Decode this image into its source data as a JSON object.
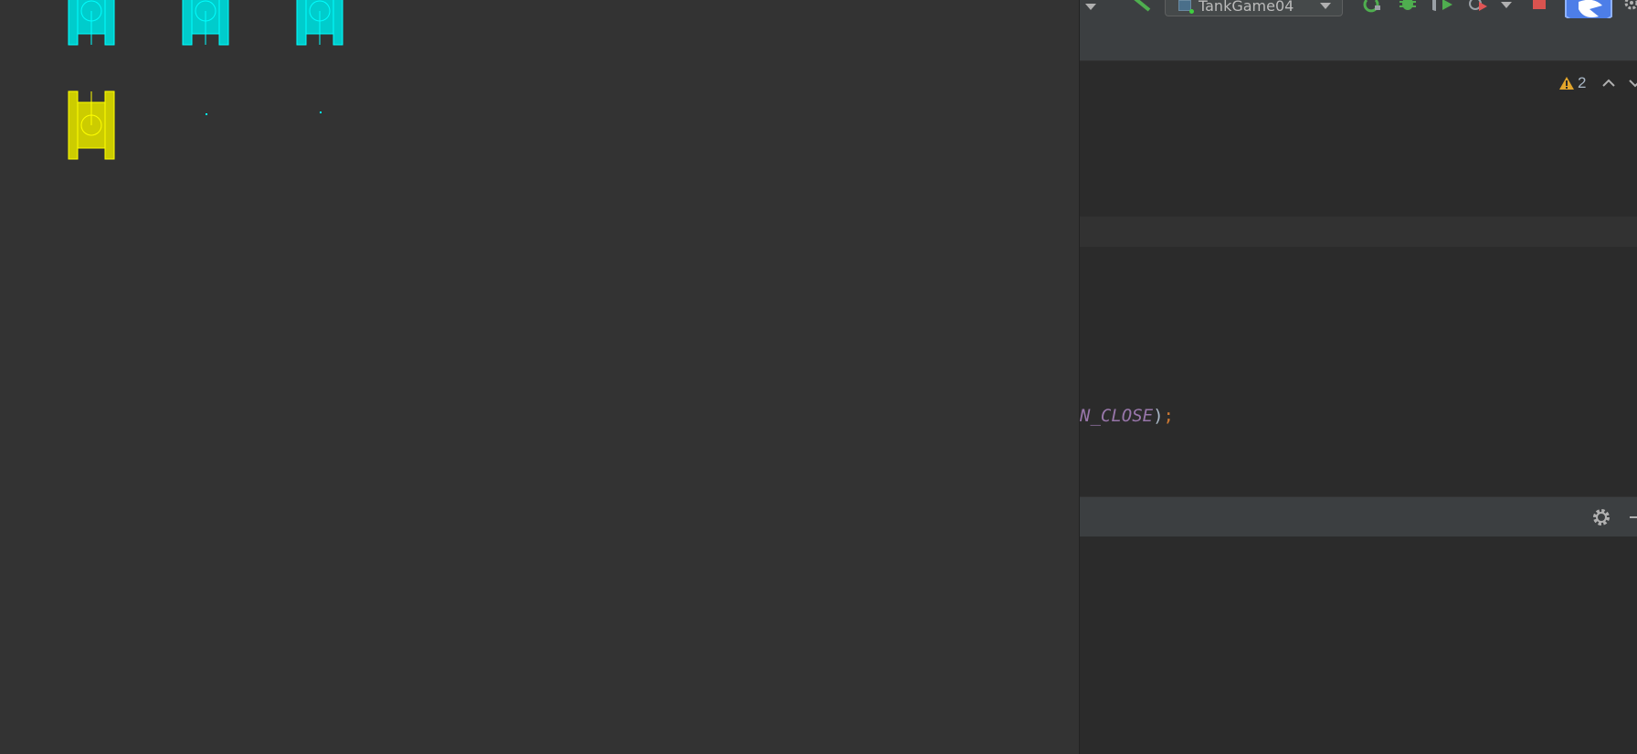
{
  "ide": {
    "run_config": {
      "label": "TankGame04"
    },
    "warning_count": "2",
    "code_fragment": {
      "const_text": "N_CLOSE",
      "paren": ")",
      "semicolon": ";"
    },
    "colors": {
      "toolbar_bg": "#3c3f41",
      "editor_bg": "#2b2b2b",
      "constant": "#9876aa",
      "keyword": "#cc7832",
      "warning": "#e2a52b"
    },
    "toolbar_icons": [
      "dropdown-arrow-icon",
      "build-hammer-icon",
      "run-config-selector",
      "rerun-icon",
      "debug-bug-icon",
      "run-with-coverage-icon",
      "profile-icon",
      "more-run-options-icon",
      "stop-icon",
      "plugin-bird-logo",
      "settings-gear-icon"
    ]
  },
  "game": {
    "background": "#333333",
    "enemy_color": "#00cccc",
    "hero_color": "#cccc00",
    "bullet_color": "#00ffff",
    "enemy_tank_count": 3,
    "hero_tank_count": 1,
    "bullet_count": 2
  }
}
